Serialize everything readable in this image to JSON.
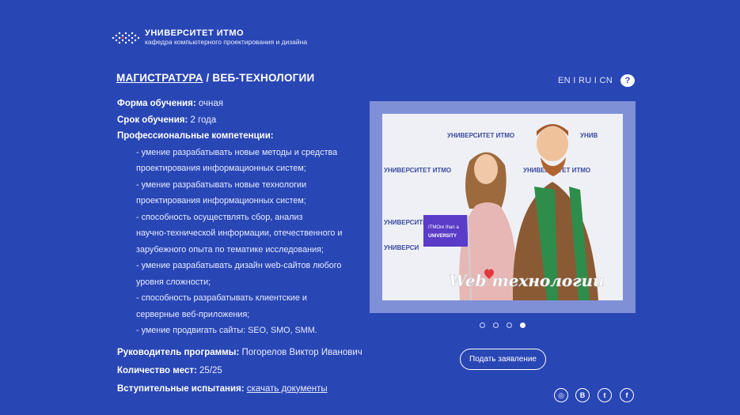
{
  "header": {
    "logo_title": "УНИВЕРСИТЕТ ИТМО",
    "logo_subtitle": "кафедра компьютерного проектирования и дизайна"
  },
  "page": {
    "crumb_link": "МАГИСТРАТУРА",
    "crumb_sep": " / ",
    "crumb_current": "ВЕБ-ТЕХНОЛОГИИ"
  },
  "lang": "EN I RU I CN",
  "help": "?",
  "info": {
    "form_label": "Форма обучения:",
    "form_value": " очная",
    "term_label": "Срок обучения:",
    "term_value": " 2 года",
    "competencies_label": "Профессиональные компетенции:",
    "competencies": [
      "- умение разрабатывать новые методы и средства",
      "проектирования информационных систем;",
      " - умение разрабатывать новые технологии",
      "проектирования информационных систем;",
      "- способность осуществлять сбор, анализ",
      "научно-технической информации, отечественного и",
      "зарубежного опыта по тематике исследования;",
      "- умение разрабатывать дизайн web-сайтов любого",
      "уровня сложности;",
      "- способность разрабатывать клиентские и",
      "серверные веб-приложения;",
      "- умение продвигать сайты: SEO, SMO, SMM."
    ],
    "head_label": "Руководитель программы:",
    "head_value": " Погорелов Виктор Иванович",
    "places_label": "Количество мест:",
    "places_value": " 25/25",
    "exams_label": "Вступительные испытания:",
    "exams_link": "скачать документы"
  },
  "photo": {
    "banner_text_1": "УНИВЕРСИТЕТ ИТМО",
    "banner_text_2": "УНИВЕРСИТЕТ ИТМО",
    "banner_text_3": "УНИВ",
    "banner_text_4": "УНИВЕРСИТЕТ ИТМО",
    "banner_text_5": "УНИВЕРСИТЕТ ИТМО",
    "banner_text_6": "УНИВЕРСИ",
    "flag_text_1": "ITMOre than a",
    "flag_text_2": "UNIVERSITY",
    "sign_text": "Web технологии"
  },
  "carousel": {
    "total": 4,
    "active_index": 3
  },
  "apply_button": "Подать заявление",
  "social": {
    "icons": [
      "instagram-icon",
      "vk-icon",
      "twitter-icon",
      "facebook-icon"
    ],
    "glyphs": [
      "◎",
      "В",
      "t",
      "f"
    ]
  },
  "colors": {
    "background": "#2946b5",
    "frame": "#7f90d6",
    "text": "#ffffff",
    "muted_text": "#e6ecff"
  }
}
